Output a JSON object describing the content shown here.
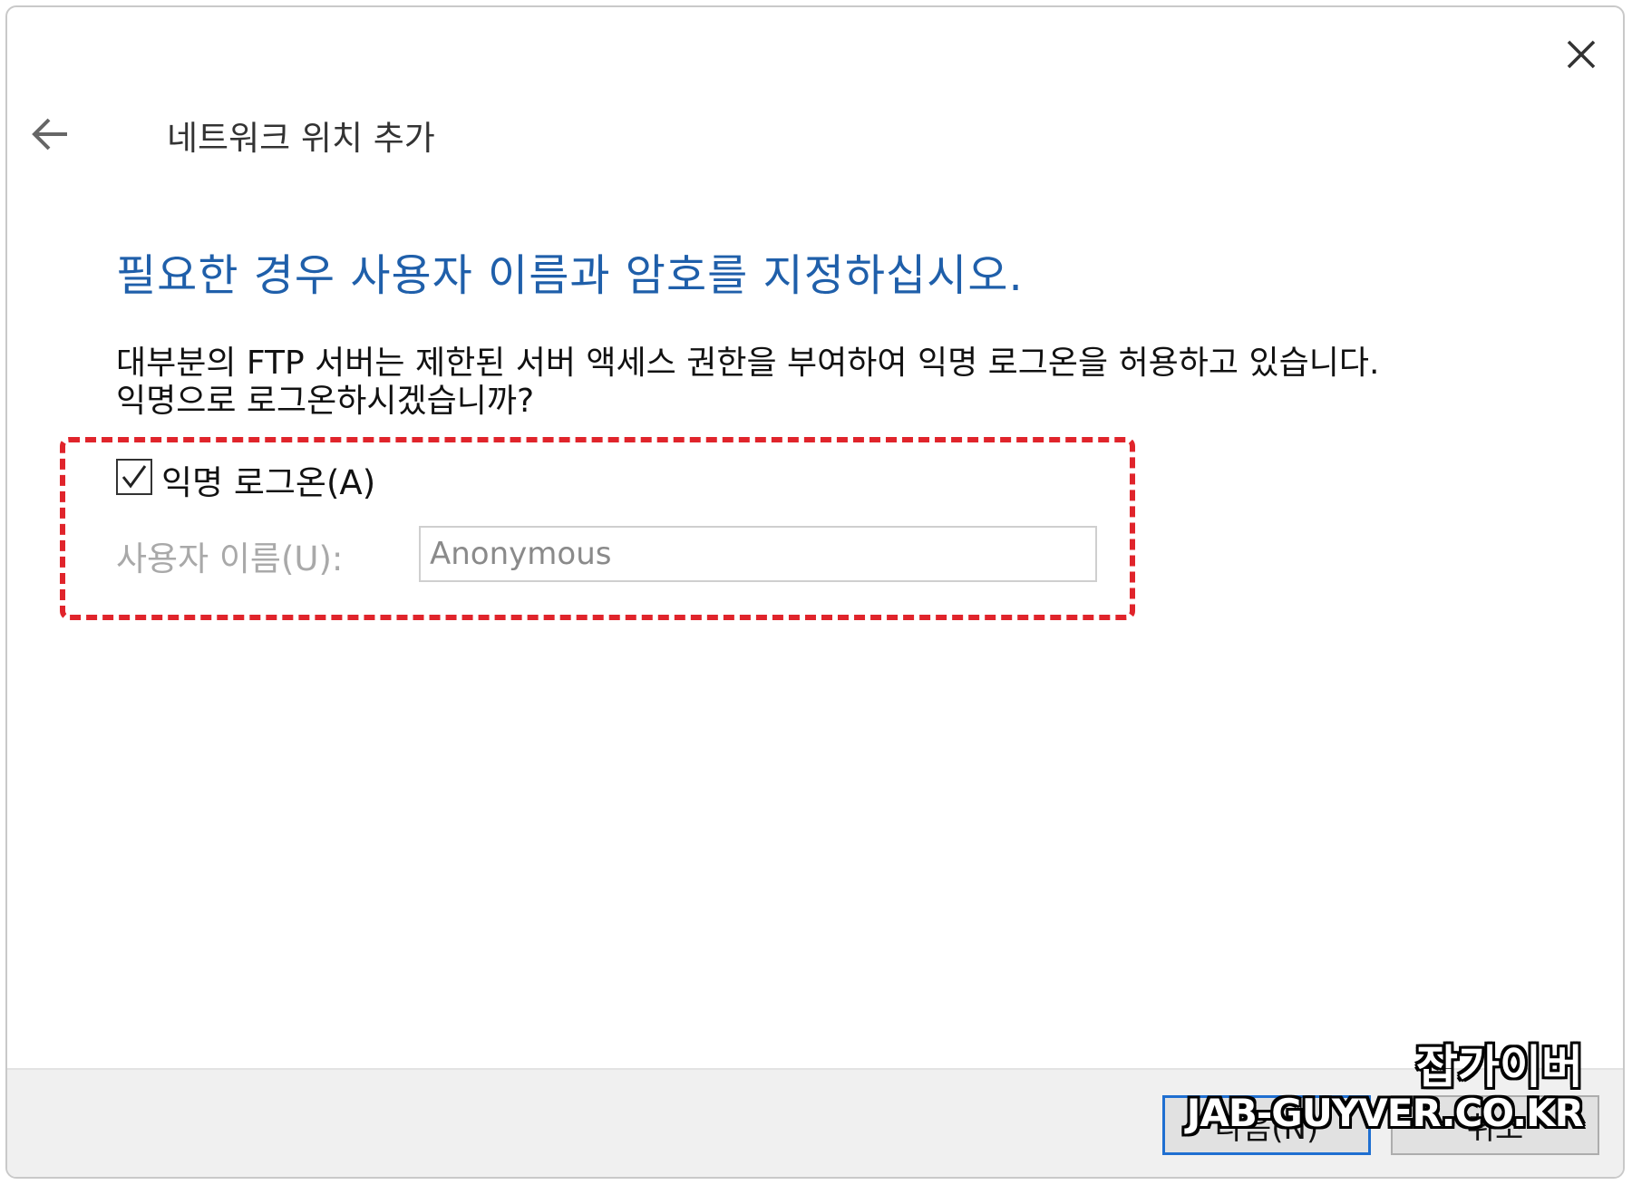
{
  "window": {
    "title": "네트워크 위치 추가"
  },
  "page": {
    "heading": "필요한 경우 사용자 이름과 암호를 지정하십시오.",
    "description_line1": "대부분의 FTP 서버는 제한된 서버 액세스 권한을 부여하여 익명 로그온을 허용하고 있습니다.",
    "description_line2": "익명으로 로그온하시겠습니까?"
  },
  "anonymous_login": {
    "label": "익명 로그온(A)",
    "checked": true
  },
  "username": {
    "label": "사용자 이름(U):",
    "value": "Anonymous",
    "disabled": true
  },
  "footer": {
    "next_label": "다음(N)",
    "cancel_label": "취소"
  },
  "watermark": {
    "line1": "잡가이버",
    "line2": "JAB-GUYVER.CO.KR"
  },
  "colors": {
    "heading": "#1f5faa",
    "highlight_border": "#e0242b",
    "default_button_border": "#1f6fd1",
    "disabled_text": "#a9a9a9"
  },
  "icons": {
    "close": "close-icon",
    "back": "back-arrow-icon",
    "check": "checkmark-icon"
  }
}
